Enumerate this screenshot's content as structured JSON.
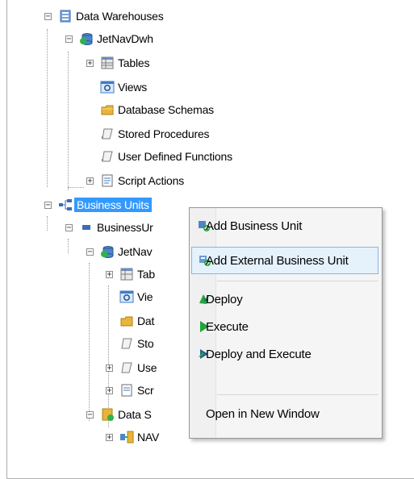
{
  "tree": {
    "data_warehouses": "Data Warehouses",
    "jetnavdwh": "JetNavDwh",
    "tables": "Tables",
    "views": "Views",
    "database_schemas": "Database Schemas",
    "stored_procedures": "Stored Procedures",
    "user_defined_functions": "User Defined Functions",
    "script_actions": "Script Actions",
    "business_units": "Business Units",
    "business_unit_child": "BusinessUr",
    "jetnav_child": "JetNav",
    "tables_short": "Tab",
    "views_short": "Vie",
    "schemas_short": "Dat",
    "stored_short": "Sto",
    "udf_short": "Use",
    "script_short": "Scr",
    "data_sources_short": "Data S",
    "nav": "NAV"
  },
  "context_menu": {
    "add_business_unit": "Add Business Unit",
    "add_external_business_unit": "Add External Business Unit",
    "deploy": "Deploy",
    "execute": "Execute",
    "deploy_and_execute": "Deploy and Execute",
    "open_in_new_window": "Open in New Window"
  },
  "colors": {
    "selection": "#3399ff",
    "menu_hover": "#e5f1fb",
    "menu_hover_border": "#8cb4e2",
    "folder": "#e8b53a",
    "db_icon": "#3a6fb5",
    "green": "#22a33b"
  }
}
